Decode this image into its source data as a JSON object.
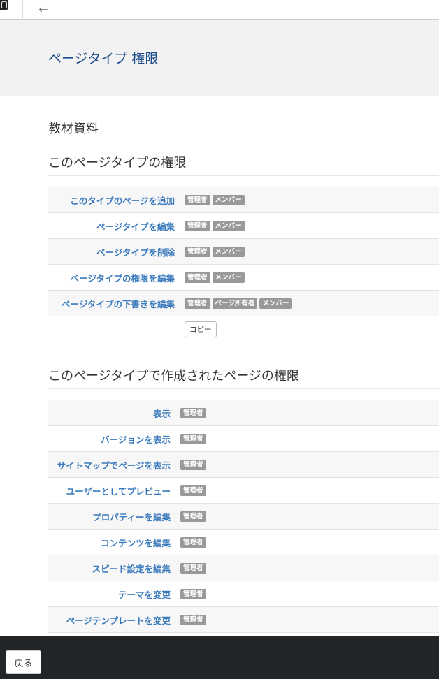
{
  "topbar": {
    "back_arrow": "←"
  },
  "header": {
    "title": "ページタイプ 権限"
  },
  "page_type_name": "教材資料",
  "section1": {
    "title": "このページタイプの権限",
    "rows": [
      {
        "label": "このタイプのページを追加",
        "badges": [
          "管理者",
          "メンバー"
        ]
      },
      {
        "label": "ページタイプを編集",
        "badges": [
          "管理者",
          "メンバー"
        ]
      },
      {
        "label": "ページタイプを削除",
        "badges": [
          "管理者",
          "メンバー"
        ]
      },
      {
        "label": "ページタイプの権限を編集",
        "badges": [
          "管理者",
          "メンバー"
        ]
      },
      {
        "label": "ページタイプの下書きを編集",
        "badges": [
          "管理者",
          "ページ所有者",
          "メンバー"
        ]
      }
    ],
    "copy_label": "コピー"
  },
  "section2": {
    "title": "このページタイプで作成されたページの権限",
    "rows": [
      {
        "label": "表示",
        "badges": [
          "管理者"
        ]
      },
      {
        "label": "バージョンを表示",
        "badges": [
          "管理者"
        ]
      },
      {
        "label": "サイトマップでページを表示",
        "badges": [
          "管理者"
        ]
      },
      {
        "label": "ユーザーとしてプレビュー",
        "badges": [
          "管理者"
        ]
      },
      {
        "label": "プロパティーを編集",
        "badges": [
          "管理者"
        ]
      },
      {
        "label": "コンテンツを編集",
        "badges": [
          "管理者"
        ]
      },
      {
        "label": "スピード設定を編集",
        "badges": [
          "管理者"
        ]
      },
      {
        "label": "テーマを変更",
        "badges": [
          "管理者"
        ]
      },
      {
        "label": "ページテンプレートを変更",
        "badges": [
          "管理者"
        ]
      }
    ]
  },
  "footer": {
    "back_label": "戻る"
  }
}
